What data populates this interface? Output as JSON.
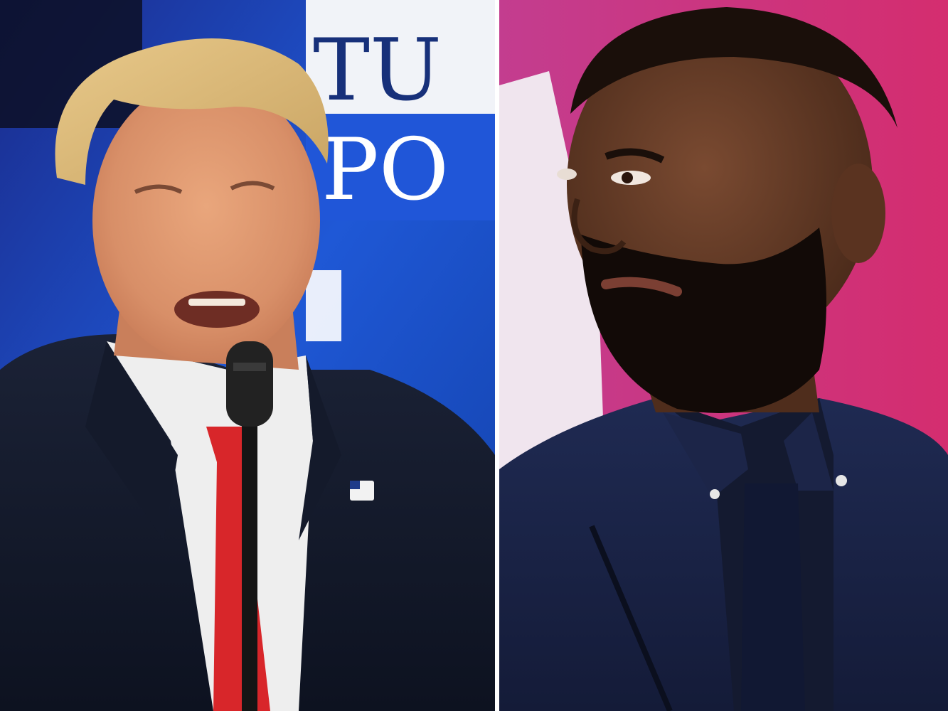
{
  "left_photo": {
    "backdrop_text_line1": "TU",
    "backdrop_text_line2": "PO",
    "backdrop_color": "#1f58d6"
  },
  "right_photo": {
    "backdrop_color": "#c92f7a"
  }
}
